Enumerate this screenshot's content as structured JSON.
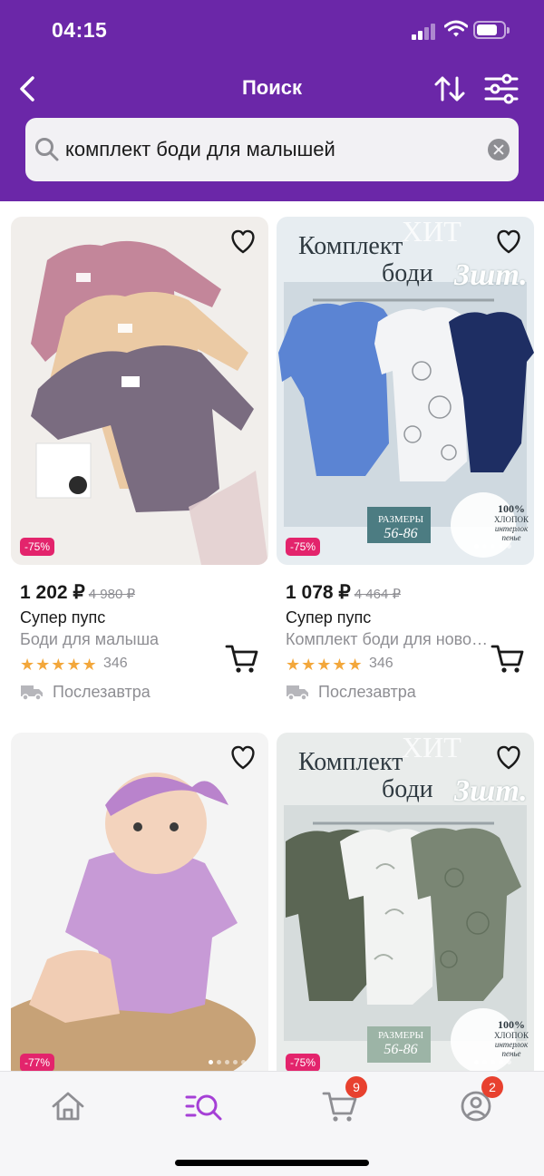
{
  "status_bar": {
    "time": "04:15"
  },
  "header": {
    "title": "Поиск",
    "back_icon": "chevron-left-icon",
    "sort_icon": "sort-arrows-icon",
    "filter_icon": "filter-sliders-icon"
  },
  "search": {
    "value": "комплект боди для малышей",
    "icon": "search-icon",
    "clear_icon": "clear-icon"
  },
  "products": [
    {
      "discount": "-75%",
      "price": "1 202 ₽",
      "old_price": "4 980 ₽",
      "brand": "Супер пупс",
      "name": "Боди для малыша",
      "rating_stars": 5,
      "stars": "★★★★★",
      "reviews": "346",
      "delivery": "Послезавтра"
    },
    {
      "discount": "-75%",
      "price": "1 078 ₽",
      "old_price": "4 464 ₽",
      "brand": "Супер пупс",
      "name": "Комплект боди для новорожденных",
      "rating_stars": 5,
      "stars": "★★★★★",
      "reviews": "346",
      "delivery": "Послезавтра",
      "image_text": {
        "line1": "Комплект",
        "line2": "боди",
        "count": "3шт.",
        "hit": "ХИТ",
        "sizes_label": "РАЗМЕРЫ",
        "sizes": "56-86",
        "cotton": "100%",
        "cotton2": "ХЛОПОК",
        "cotton3": "интерлок",
        "cotton4": "пенье"
      }
    },
    {
      "discount": "-77%"
    },
    {
      "discount": "-75%",
      "image_text": {
        "line1": "Комплект",
        "line2": "боди",
        "count": "3шт.",
        "hit": "ХИТ",
        "sizes_label": "РАЗМЕРЫ",
        "sizes": "56-86",
        "cotton": "100%",
        "cotton2": "ХЛОПОК",
        "cotton3": "интерлок",
        "cotton4": "пенье"
      }
    }
  ],
  "bottom_nav": {
    "items": [
      {
        "icon": "home-icon"
      },
      {
        "icon": "search-catalog-icon",
        "active": true
      },
      {
        "icon": "cart-icon",
        "badge": "9"
      },
      {
        "icon": "profile-icon",
        "badge": "2"
      }
    ]
  },
  "colors": {
    "brand": "#6b27a8",
    "accent": "#a53fd6",
    "discount": "#e3246c",
    "stars": "#f3a73b",
    "badge": "#e8412f"
  }
}
